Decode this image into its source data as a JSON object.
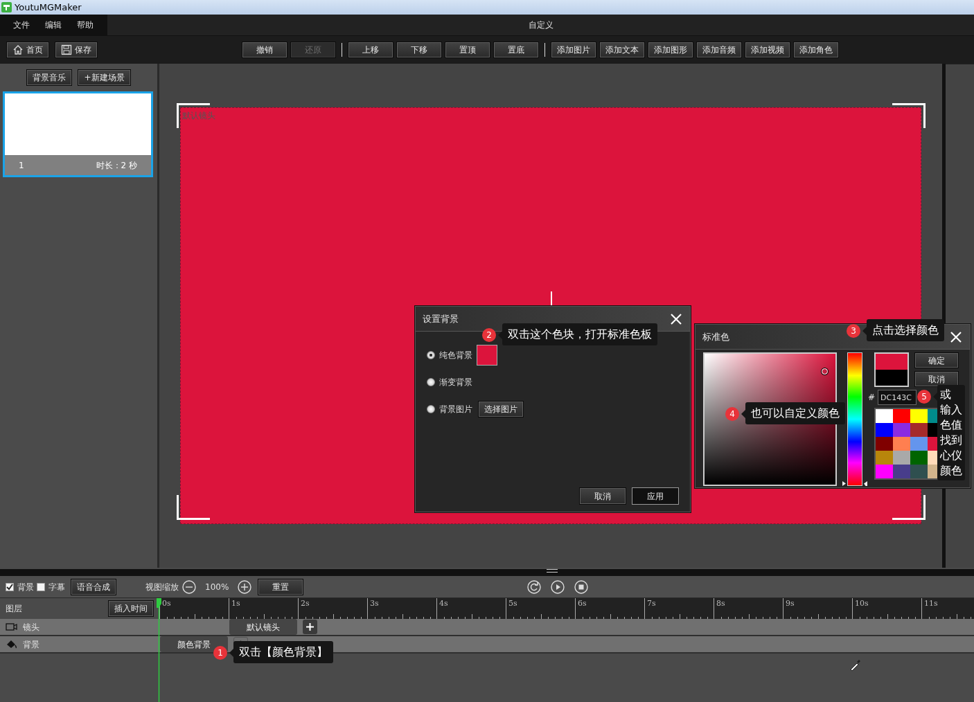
{
  "title_bar": {
    "app_name": "YoutuMGMaker"
  },
  "menu": [
    {
      "label": "文件"
    },
    {
      "label": "编辑"
    },
    {
      "label": "帮助"
    }
  ],
  "window_title": "自定义",
  "toolbar": {
    "left": [
      {
        "label": "首页",
        "kind": "home"
      },
      {
        "label": "保存",
        "kind": "save"
      }
    ],
    "groups": [
      [
        {
          "label": "撤销",
          "disabled": false
        },
        {
          "label": "还原",
          "disabled": true
        }
      ],
      [
        {
          "label": "上移",
          "disabled": false
        },
        {
          "label": "下移",
          "disabled": false
        },
        {
          "label": "置顶",
          "disabled": false
        },
        {
          "label": "置底",
          "disabled": false
        }
      ],
      [
        {
          "label": "添加图片",
          "disabled": false
        },
        {
          "label": "添加文本",
          "disabled": false
        },
        {
          "label": "添加图形",
          "disabled": false
        },
        {
          "label": "添加音频",
          "disabled": false
        },
        {
          "label": "添加视频",
          "disabled": false
        },
        {
          "label": "添加角色",
          "disabled": false
        }
      ]
    ]
  },
  "scene_panel": {
    "buttons": [
      "背景音乐",
      "+新建场景"
    ],
    "scenes": [
      {
        "number": "1",
        "duration": "时长：2 秒",
        "selected": true
      }
    ]
  },
  "stage": {
    "camera_label": "默认镜头"
  },
  "timeline_bar": {
    "toggles": [
      {
        "label": "背景",
        "checked": true
      },
      {
        "label": "字幕",
        "checked": false
      }
    ],
    "tts_button": "语音合成",
    "zoom_label": "视图缩放",
    "zoom_value": "100%",
    "reset_button": "重置"
  },
  "timeline": {
    "header": "图层",
    "insert_button": "插入时间",
    "ruler": [
      "0s",
      "1s",
      "2s",
      "3s",
      "4s",
      "5s",
      "6s",
      "7s",
      "8s",
      "9s",
      "10s",
      "11s"
    ],
    "tracks": [
      {
        "name": "镜头",
        "kind": "camera",
        "clip": "默认镜头",
        "add_disabled": false
      },
      {
        "name": "背景",
        "kind": "background",
        "clip": "颜色背景",
        "add_disabled": true
      }
    ]
  },
  "background_dialog": {
    "title": "设置背景",
    "color": "#dc143c",
    "options": [
      {
        "label": "纯色背景",
        "kind": "color",
        "selected": true
      },
      {
        "label": "渐变背景",
        "kind": "plain",
        "selected": false
      },
      {
        "label": "背景图片",
        "kind": "image",
        "selected": false,
        "button": "选择图片"
      }
    ],
    "buttons": [
      "取消",
      "应用"
    ]
  },
  "color_dialog": {
    "title": "标准色",
    "hue_slider": {
      "level": 0
    },
    "buttons": [
      "确定",
      "取消"
    ],
    "hex_prefix": "#",
    "hex_value": "DC143C",
    "swatches": [
      {
        "color": "#ffffff"
      },
      {
        "color": "#ff0000"
      },
      {
        "color": "#ffff00"
      },
      {
        "color": "#008b8b"
      },
      {
        "color": "#0000ff"
      },
      {
        "color": "#8a2be2"
      },
      {
        "color": "#a52a2a"
      },
      {
        "color": "#000000"
      },
      {
        "color": "#800000"
      },
      {
        "color": "#ff7f50"
      },
      {
        "color": "#6495ed"
      },
      {
        "color": "#dc143c"
      },
      {
        "color": "#b8860b"
      },
      {
        "color": "#a9a9a9"
      },
      {
        "color": "#006400"
      },
      {
        "color": "#ffdab9"
      },
      {
        "color": "#ff00ff"
      },
      {
        "color": "#483d8b"
      },
      {
        "color": "#2f4f4f"
      },
      {
        "color": "#d2b48c"
      }
    ]
  },
  "callouts": [
    {
      "number": "1",
      "text": "双击【颜色背景】"
    },
    {
      "number": "2",
      "text": "双击这个色块，打开标准色板"
    },
    {
      "number": "3",
      "text": "点击选择颜色"
    },
    {
      "number": "4",
      "text": "也可以自定义颜色"
    },
    {
      "number": "5",
      "text": "或输入色值找到心仪颜色"
    }
  ]
}
